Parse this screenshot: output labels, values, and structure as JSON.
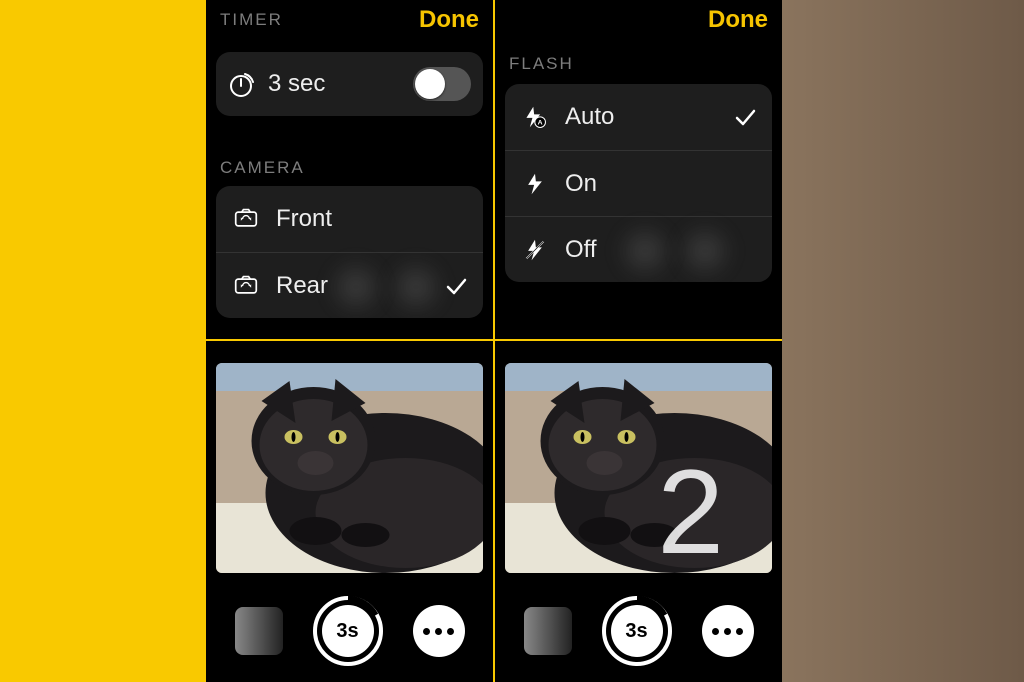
{
  "colors": {
    "accent": "#f6c400"
  },
  "panel1": {
    "done": "Done",
    "timer_section": "TIMER",
    "timer_value": "3 sec",
    "timer_on": false,
    "camera_section": "CAMERA",
    "options": [
      {
        "label": "Front",
        "selected": false
      },
      {
        "label": "Rear",
        "selected": true
      }
    ]
  },
  "panel2": {
    "done": "Done",
    "flash_section": "FLASH",
    "options": [
      {
        "label": "Auto",
        "selected": true
      },
      {
        "label": "On",
        "selected": false
      },
      {
        "label": "Off",
        "selected": false
      }
    ]
  },
  "panel3": {
    "shutter_label": "3s"
  },
  "panel4": {
    "shutter_label": "3s",
    "countdown": "2"
  }
}
